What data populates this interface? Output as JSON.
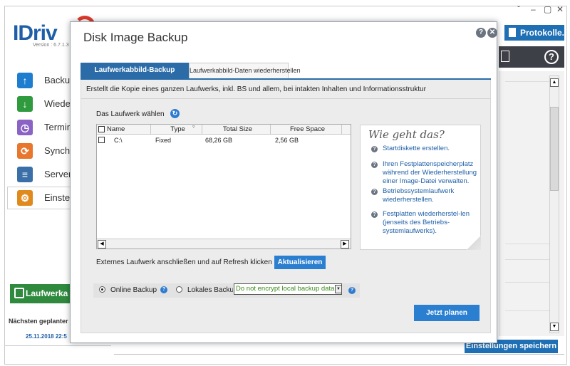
{
  "app": {
    "logo": "IDriv",
    "version": "Version : 6.7.1.3",
    "window_controls": [
      "ˇ",
      "–",
      "▢",
      "✕"
    ],
    "protokolle_label": "Protokolle...",
    "help_label": "?",
    "sidebar": [
      {
        "label": "Backu",
        "icon": "backup-up-arrow-icon",
        "color": "#1f7dd0"
      },
      {
        "label": "Wiede",
        "icon": "restore-down-arrow-icon",
        "color": "#2f9a3e"
      },
      {
        "label": "Termin",
        "icon": "clock-icon",
        "color": "#8a63c4"
      },
      {
        "label": "Synch",
        "icon": "sync-icon",
        "color": "#e8762d"
      },
      {
        "label": "Server-",
        "icon": "server-icon",
        "color": "#3a6fa8"
      },
      {
        "label": "Einstell",
        "icon": "settings-gear-icon",
        "color": "#e08a1e"
      }
    ],
    "laufwerk_label": "Laufwerka",
    "next_scheduled_label": "Nächsten geplanter",
    "next_scheduled_date": "25.11.2018 22:5",
    "save_settings_label": "Einstellungen speichern"
  },
  "dialog": {
    "title": "Disk Image Backup",
    "help": "?",
    "close": "✕",
    "tabs": [
      {
        "label": "Laufwerkabbild-Backup",
        "active": true
      },
      {
        "label": "Laufwerkabbild-Daten wiederherstellen",
        "active": false
      }
    ],
    "description": "Erstellt die Kopie eines ganzen Laufwerks, inkl. BS und allem, bei intakten Inhalten und Informationsstruktur",
    "select_drive_label": "Das Laufwerk wählen",
    "table": {
      "columns": [
        "Name",
        "Type",
        "Total Size",
        "Free Space"
      ],
      "rows": [
        {
          "name": "C:\\",
          "type": "Fixed",
          "total": "68,26 GB",
          "free": "2,56 GB"
        }
      ]
    },
    "howto": {
      "title": "Wie geht das?",
      "items": [
        "Startdiskette erstellen.",
        "Ihren Festplattenspeicherplatz während der Wiederherstellung einer Image-Datei verwalten.",
        "Betriebssystemlaufwerk wiederherstellen.",
        "Festplatten wiederherstel-len (jenseits des Betriebs-systemlaufwerks)."
      ]
    },
    "external_drive_label": "Externes Laufwerk anschließen und auf Refresh klicken",
    "refresh_button": "Aktualisieren",
    "online_backup_label": "Online Backup",
    "local_backup_label": "Lokales Backu",
    "encryption_value": "Do not encrypt local backup data",
    "schedule_button": "Jetzt planen",
    "colors": {
      "accent": "#2b7fd0",
      "tab_active": "#2b6ca8",
      "select_text": "#3a8a1a"
    }
  }
}
